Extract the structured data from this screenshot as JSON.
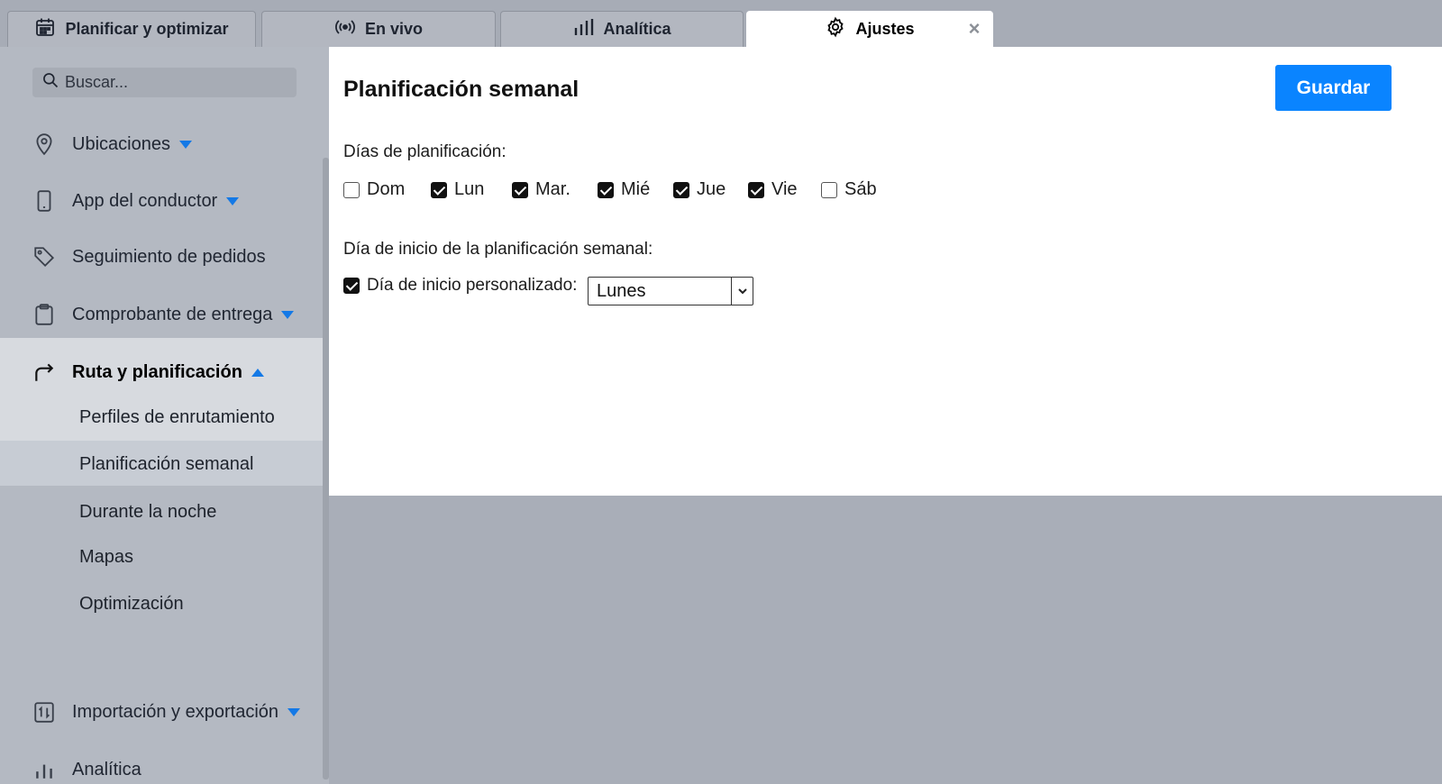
{
  "tabs": [
    {
      "label": "Planificar y optimizar",
      "icon": "calendar-icon"
    },
    {
      "label": "En vivo",
      "icon": "broadcast-icon"
    },
    {
      "label": "Analítica",
      "icon": "bar-chart-icon"
    },
    {
      "label": "Ajustes",
      "icon": "gear-icon",
      "active": true
    }
  ],
  "close_symbol": "×",
  "sidebar": {
    "search_placeholder": "Buscar...",
    "items": [
      {
        "label": "Ubicaciones",
        "icon": "location-pin-icon",
        "caret": "down"
      },
      {
        "label": "App del conductor",
        "icon": "phone-icon",
        "caret": "down"
      },
      {
        "label": "Seguimiento de pedidos",
        "icon": "tag-icon"
      },
      {
        "label": "Comprobante de entrega",
        "icon": "clipboard-icon",
        "caret": "down"
      },
      {
        "label": "Ruta y planificación",
        "icon": "turn-right-arrow-icon",
        "caret": "up",
        "expanded": true
      },
      {
        "label": "Importación y exportación",
        "icon": "import-export-icon",
        "caret": "down"
      },
      {
        "label": "Analítica",
        "icon": "bar-chart-icon"
      }
    ],
    "sub_items": [
      "Perfiles de enrutamiento",
      "Planificación semanal",
      "Durante la noche",
      "Mapas",
      "Optimización"
    ],
    "selected_sub_item": "Planificación semanal"
  },
  "panel": {
    "title": "Planificación semanal",
    "save_label": "Guardar",
    "planning_days_label": "Días de planificación:",
    "days": [
      {
        "label": "Dom",
        "checked": false
      },
      {
        "label": "Lun",
        "checked": true
      },
      {
        "label": "Mar.",
        "checked": true
      },
      {
        "label": "Mié",
        "checked": true
      },
      {
        "label": "Jue",
        "checked": true
      },
      {
        "label": "Vie",
        "checked": true
      },
      {
        "label": "Sáb",
        "checked": false
      }
    ],
    "start_day_label": "Día de inicio de la planificación semanal:",
    "custom_start_label": "Día de inicio personalizado:",
    "custom_start_checked": true,
    "start_day_value": "Lunes"
  },
  "colors": {
    "accent": "#0a84ff",
    "caret": "#1479e6",
    "background": "#a9aeb8",
    "sidebar": "#b4b9c2",
    "panel": "#ffffff"
  }
}
